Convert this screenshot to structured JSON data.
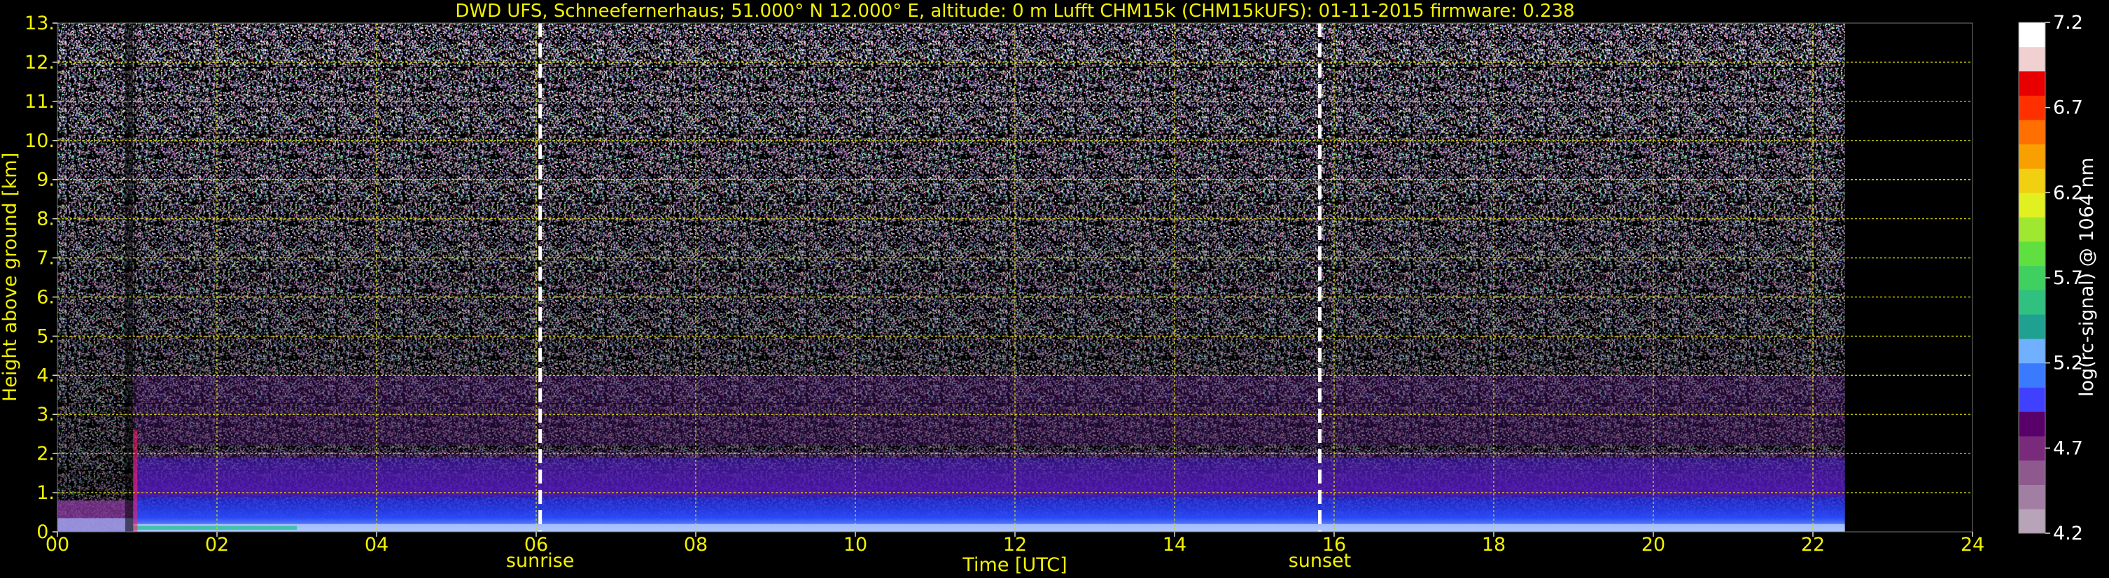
{
  "chart_data": {
    "type": "heatmap",
    "title": "DWD UFS, Schneefernerhaus; 51.000° N 12.000° E, altitude: 0 m    Lufft CHM15k (CHM15kUFS): 01-11-2015    firmware: 0.238",
    "xlabel": "Time [UTC]",
    "ylabel": "Height above ground [km]",
    "xlim": [
      0,
      24
    ],
    "ylim": [
      0,
      13
    ],
    "x_ticks": [
      0,
      2,
      4,
      6,
      8,
      10,
      12,
      14,
      16,
      18,
      20,
      22,
      24
    ],
    "x_tick_labels": [
      "00",
      "02",
      "04",
      "06",
      "08",
      "10",
      "12",
      "14",
      "16",
      "18",
      "20",
      "22",
      "24"
    ],
    "y_ticks": [
      0,
      1,
      2,
      3,
      4,
      5,
      6,
      7,
      8,
      9,
      10,
      11,
      12,
      13
    ],
    "y_tick_labels": [
      "0.",
      "1.",
      "2.",
      "3.",
      "4.",
      "5.",
      "6.",
      "7.",
      "8.",
      "9.",
      "10.",
      "11.",
      "12.",
      "13."
    ],
    "grid": true,
    "data_end_time": 22.4,
    "annotations": [
      {
        "label": "sunrise",
        "x": 6.05
      },
      {
        "label": "sunset",
        "x": 15.82
      }
    ],
    "signal_layers": [
      {
        "time": [
          0.0,
          0.95
        ],
        "height_km": [
          0.0,
          0.8
        ],
        "level": 4.7,
        "note": "low layer before 01 UTC"
      },
      {
        "time": [
          0.95,
          22.4
        ],
        "height_km": [
          0.0,
          0.9
        ],
        "level": 5.1
      },
      {
        "time": [
          0.95,
          22.4
        ],
        "height_km": [
          0.9,
          2.2
        ],
        "level": 4.8
      },
      {
        "time": [
          0.95,
          22.4
        ],
        "height_km": [
          2.2,
          4.0
        ],
        "level": 4.5
      }
    ],
    "colorbar": {
      "label": "log(rc-signal) @ 1064 nm",
      "min": 4.2,
      "max": 7.2,
      "ticks": [
        4.2,
        4.7,
        5.2,
        5.7,
        6.2,
        6.7,
        7.2
      ],
      "tick_labels": [
        "4.2",
        "4.7",
        "5.2",
        "5.7",
        "6.2",
        "6.7",
        "7.2"
      ],
      "colors": [
        "#b8a4b8",
        "#a27ea2",
        "#8e5a8e",
        "#7a2a7a",
        "#5a006a",
        "#4040ff",
        "#3a7aff",
        "#70b0ff",
        "#20a090",
        "#30c080",
        "#40d060",
        "#60e040",
        "#a0e830",
        "#e0f020",
        "#f0d010",
        "#f8a000",
        "#ff7000",
        "#ff3000",
        "#e80000",
        "#f0d0d0",
        "#ffffff"
      ]
    }
  }
}
